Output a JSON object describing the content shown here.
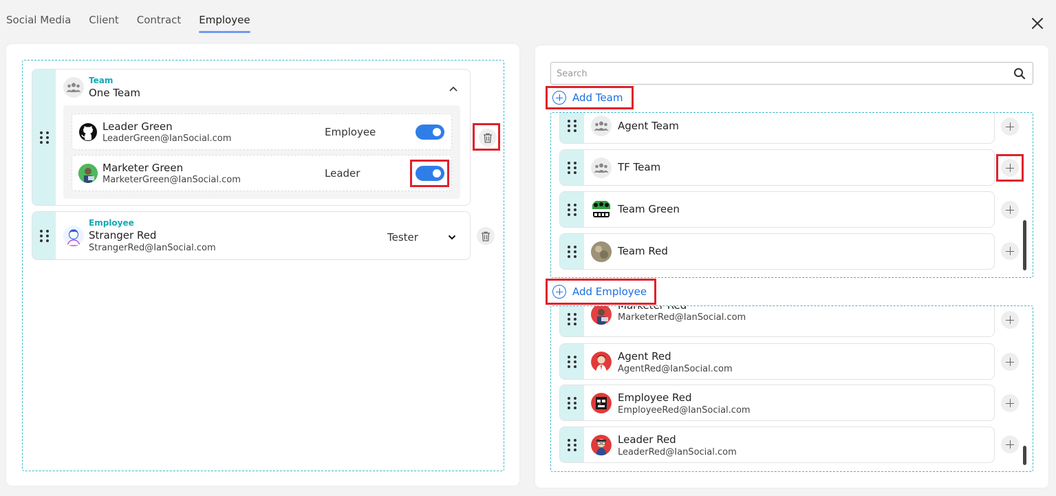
{
  "tabs": [
    {
      "label": "Social Media",
      "active": false
    },
    {
      "label": "Client",
      "active": false
    },
    {
      "label": "Contract",
      "active": false
    },
    {
      "label": "Employee",
      "active": true
    }
  ],
  "left": {
    "team_card": {
      "type_label": "Team",
      "name": "One Team",
      "members": [
        {
          "name": "Leader Green",
          "email": "LeaderGreen@IanSocial.com",
          "role": "Employee",
          "toggle_on": true,
          "avatar_icon": "github-icon"
        },
        {
          "name": "Marketer Green",
          "email": "MarketerGreen@IanSocial.com",
          "role": "Leader",
          "toggle_on": true,
          "avatar_icon": "user-avatar"
        }
      ]
    },
    "employee_card": {
      "type_label": "Employee",
      "name": "Stranger Red",
      "email": "StrangerRed@IanSocial.com",
      "role_select": "Tester"
    }
  },
  "right": {
    "search_placeholder": "Search",
    "add_team_label": "Add Team",
    "add_employee_label": "Add Employee",
    "teams": [
      {
        "name": "Agent Team"
      },
      {
        "name": "TF Team"
      },
      {
        "name": "Team Green"
      },
      {
        "name": "Team Red"
      }
    ],
    "employees": [
      {
        "name": "Marketer Red",
        "email": "MarketerRed@IanSocial.com"
      },
      {
        "name": "Agent Red",
        "email": "AgentRed@IanSocial.com"
      },
      {
        "name": "Employee Red",
        "email": "EmployeeRed@IanSocial.com"
      },
      {
        "name": "Leader Red",
        "email": "LeaderRed@IanSocial.com"
      }
    ]
  },
  "colors": {
    "accent": "#2f7ee8",
    "teal_label": "#14a9b3",
    "drag_strip": "#d7f2f3",
    "highlight_red": "#e0212b",
    "link_blue": "#1b6fe0"
  }
}
